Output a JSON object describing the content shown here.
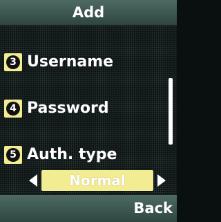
{
  "header": {
    "title": "Add"
  },
  "items": [
    {
      "number": "3",
      "label": "Username"
    },
    {
      "number": "4",
      "label": "Password"
    },
    {
      "number": "5",
      "label": "Auth. type"
    }
  ],
  "auth_selector": {
    "value": "Normal"
  },
  "softkeys": {
    "right_label": "Back"
  },
  "colors": {
    "highlight": "#f2ec93",
    "bar": "#3d5751",
    "background": "#0b1010"
  }
}
